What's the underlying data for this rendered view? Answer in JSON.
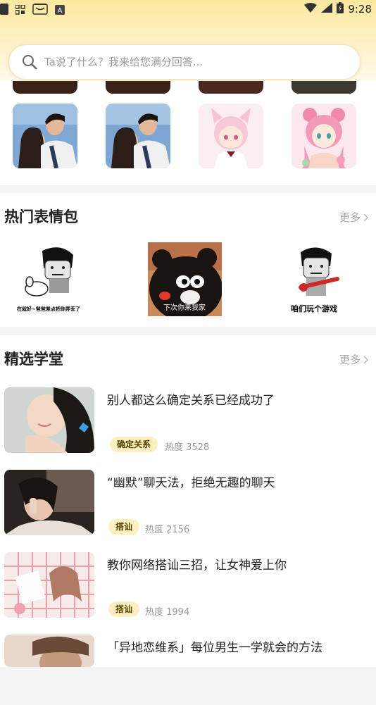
{
  "status_bar": {
    "time": "9:28",
    "icons_left": [
      "app-icon",
      "grid-icon",
      "cat-icon",
      "a-box-icon"
    ],
    "icons_right": [
      "wifi-icon",
      "signal-icon",
      "battery-icon"
    ]
  },
  "search": {
    "placeholder": "Ta说了什么？我来给您满分回答..."
  },
  "avatars": [
    {
      "name": "couple-avatar-1"
    },
    {
      "name": "couple-avatar-2"
    },
    {
      "name": "anime-cat-boy-avatar"
    },
    {
      "name": "anime-pink-girl-avatar"
    }
  ],
  "memes": {
    "title": "热门表情包",
    "more": "更多",
    "items": [
      {
        "caption": "在就好~爸爸差点把你弄丢了"
      },
      {
        "caption": "下次你来我家"
      },
      {
        "caption": "咱们玩个游戏"
      }
    ]
  },
  "academy": {
    "title": "精选学堂",
    "more": "更多",
    "heat_label": "热度",
    "articles": [
      {
        "title": "别人都这么确定关系已经成功了",
        "tag": "确定关系",
        "heat": "热度 3528"
      },
      {
        "title": "“幽默”聊天法，拒绝无趣的聊天",
        "tag": "搭讪",
        "heat": "热度 2156"
      },
      {
        "title": "教你网络搭讪三招，让女神爱上你",
        "tag": "搭讪",
        "heat": "热度 1994"
      },
      {
        "title": "「异地恋维系」每位男生一学就会的方法",
        "tag": "",
        "heat": ""
      }
    ]
  },
  "colors": {
    "accent": "#fde8a0",
    "tag_bg": "#fdf0c0"
  }
}
